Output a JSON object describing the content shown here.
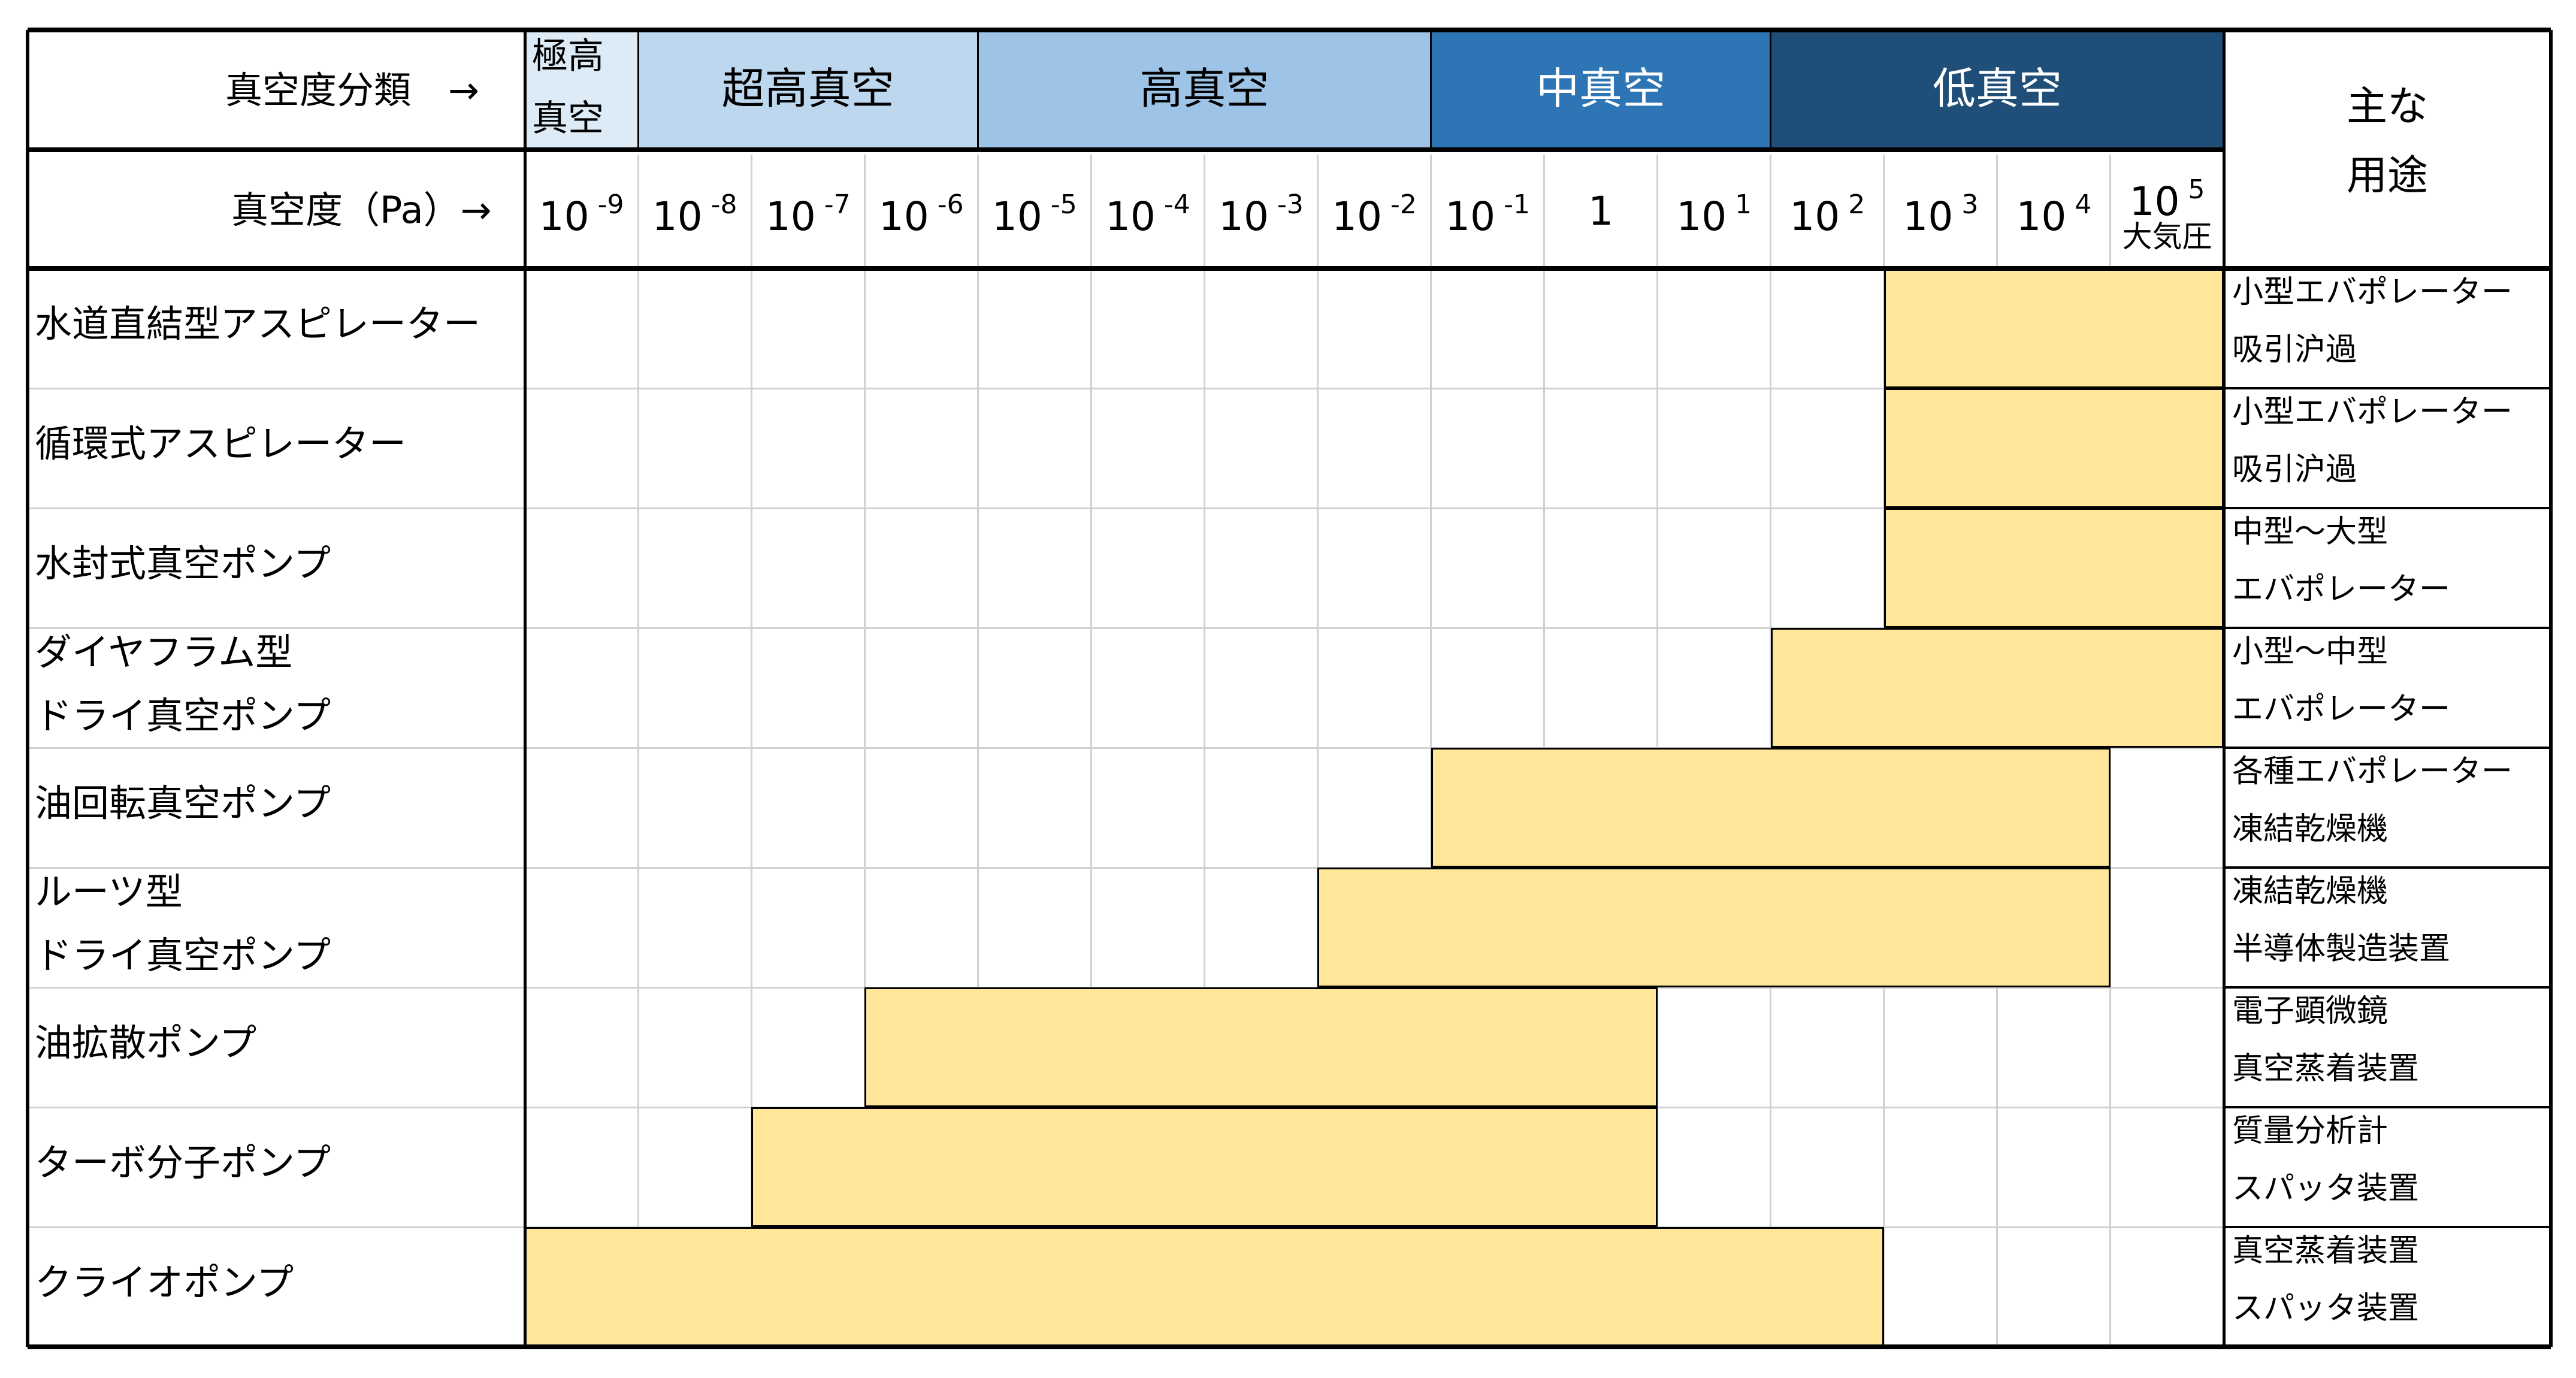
{
  "chart_data": {
    "type": "table",
    "title": "",
    "header": {
      "category_label": "真空度分類　→",
      "pressure_label": "真空度（Pa）→",
      "use_label_line1": "主な",
      "use_label_line2": "用途"
    },
    "pressure_columns": [
      {
        "base": "10",
        "exp": "-9"
      },
      {
        "base": "10",
        "exp": "-8"
      },
      {
        "base": "10",
        "exp": "-7"
      },
      {
        "base": "10",
        "exp": "-6"
      },
      {
        "base": "10",
        "exp": "-5"
      },
      {
        "base": "10",
        "exp": "-4"
      },
      {
        "base": "10",
        "exp": "-3"
      },
      {
        "base": "10",
        "exp": "-2"
      },
      {
        "base": "10",
        "exp": "-1"
      },
      {
        "base": "1",
        "exp": ""
      },
      {
        "base": "10",
        "exp": "1"
      },
      {
        "base": "10",
        "exp": "2"
      },
      {
        "base": "10",
        "exp": "3"
      },
      {
        "base": "10",
        "exp": "4"
      },
      {
        "base": "10",
        "exp": "5",
        "note": "大気圧"
      }
    ],
    "vacuum_classes": [
      {
        "name_line1": "極高",
        "name_line2": "真空",
        "from_col": 0,
        "to_col": 0,
        "color": "#DDEBF7",
        "text_color": "#000000"
      },
      {
        "name_line1": "超高真空",
        "name_line2": "",
        "from_col": 1,
        "to_col": 3,
        "color": "#BDD7EE",
        "text_color": "#000000"
      },
      {
        "name_line1": "高真空",
        "name_line2": "",
        "from_col": 4,
        "to_col": 7,
        "color": "#9DC3E6",
        "text_color": "#000000"
      },
      {
        "name_line1": "中真空",
        "name_line2": "",
        "from_col": 8,
        "to_col": 10,
        "color": "#2E75B6",
        "text_color": "#FFFFFF"
      },
      {
        "name_line1": "低真空",
        "name_line2": "",
        "from_col": 11,
        "to_col": 14,
        "color": "#1F4E79",
        "text_color": "#FFFFFF"
      }
    ],
    "bar_color": "#FFE699",
    "pumps": [
      {
        "name_line1": "水道直結型アスピレーター",
        "name_line2": "",
        "range_from_exp": 3,
        "range_to_exp": 5,
        "from_col": 12,
        "to_col": 14,
        "use_line1": "小型エバポレーター",
        "use_line2": "吸引沪過"
      },
      {
        "name_line1": "循環式アスピレーター",
        "name_line2": "",
        "range_from_exp": 3,
        "range_to_exp": 5,
        "from_col": 12,
        "to_col": 14,
        "use_line1": "小型エバポレーター",
        "use_line2": "吸引沪過"
      },
      {
        "name_line1": "水封式真空ポンプ",
        "name_line2": "",
        "range_from_exp": 3,
        "range_to_exp": 5,
        "from_col": 12,
        "to_col": 14,
        "use_line1": "中型～大型",
        "use_line2": "エバポレーター"
      },
      {
        "name_line1": "ダイヤフラム型",
        "name_line2": "ドライ真空ポンプ",
        "range_from_exp": 2,
        "range_to_exp": 5,
        "from_col": 11,
        "to_col": 14,
        "use_line1": "小型～中型",
        "use_line2": "エバポレーター"
      },
      {
        "name_line1": "油回転真空ポンプ",
        "name_line2": "",
        "range_from_exp": -1,
        "range_to_exp": 4,
        "from_col": 8,
        "to_col": 13,
        "use_line1": "各種エバポレーター",
        "use_line2": "凍結乾燥機"
      },
      {
        "name_line1": "ルーツ型",
        "name_line2": "ドライ真空ポンプ",
        "range_from_exp": -2,
        "range_to_exp": 4,
        "from_col": 7,
        "to_col": 13,
        "use_line1": "凍結乾燥機",
        "use_line2": "半導体製造装置"
      },
      {
        "name_line1": "油拡散ポンプ",
        "name_line2": "",
        "range_from_exp": -6,
        "range_to_exp": 0,
        "from_col": 3,
        "to_col": 9,
        "use_line1": "電子顕微鏡",
        "use_line2": "真空蒸着装置"
      },
      {
        "name_line1": "ターボ分子ポンプ",
        "name_line2": "",
        "range_from_exp": -7,
        "range_to_exp": 0,
        "from_col": 2,
        "to_col": 9,
        "use_line1": "質量分析計",
        "use_line2": "スパッタ装置"
      },
      {
        "name_line1": "クライオポンプ",
        "name_line2": "",
        "range_from_exp": -9,
        "range_to_exp": 2,
        "from_col": 0,
        "to_col": 11,
        "use_line1": "真空蒸着装置",
        "use_line2": "スパッタ装置"
      }
    ]
  }
}
